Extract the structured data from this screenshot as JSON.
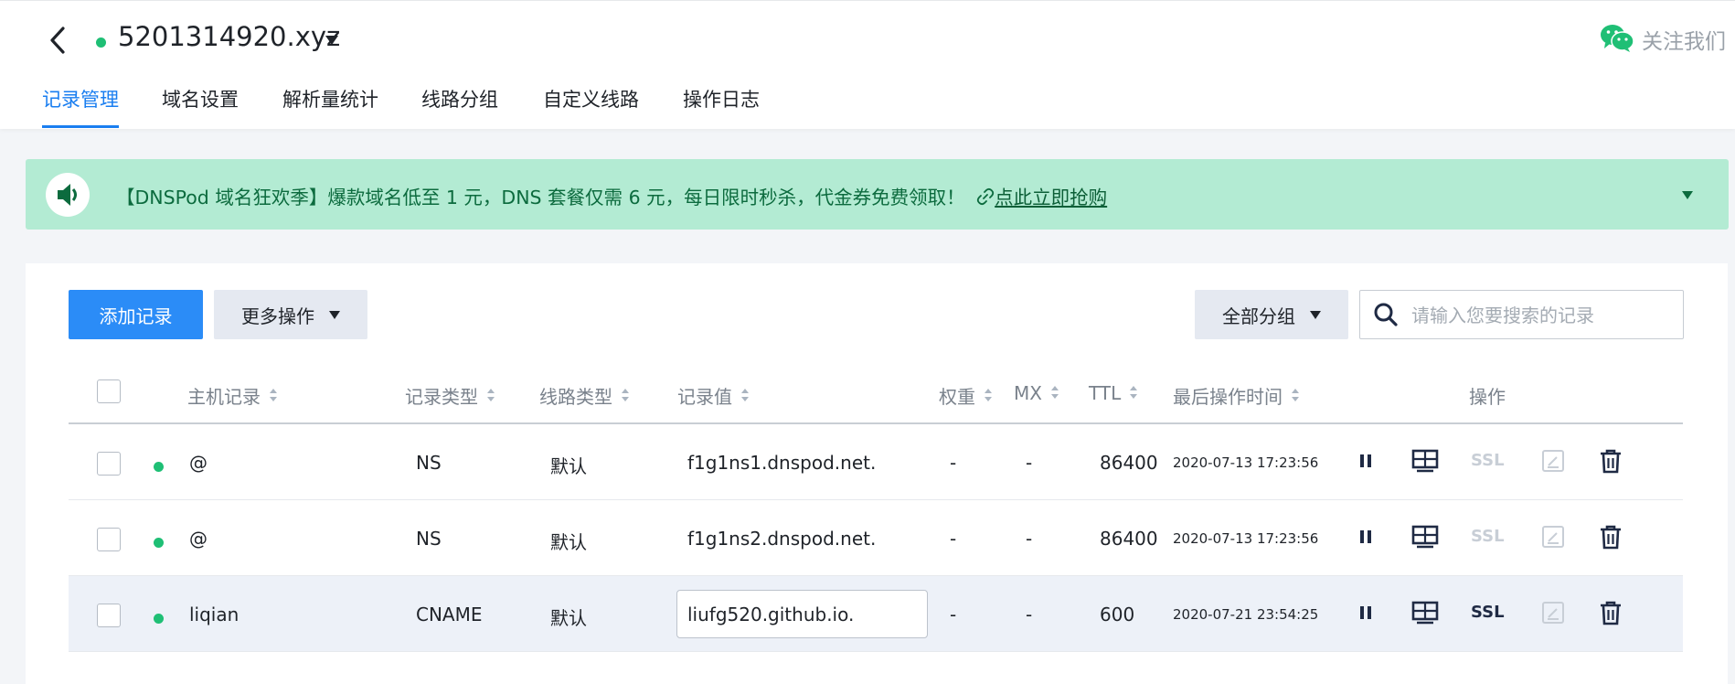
{
  "header": {
    "domain": "5201314920.xyz",
    "follow_label": "关注我们",
    "tabs": [
      "记录管理",
      "域名设置",
      "解析量统计",
      "线路分组",
      "自定义线路",
      "操作日志"
    ],
    "active_tab": "记录管理"
  },
  "banner": {
    "text": "【DNSPod 域名狂欢季】爆款域名低至 1 元，DNS 套餐仅需 6 元，每日限时秒杀，代金券免费领取！",
    "link": "点此立即抢购"
  },
  "toolbar": {
    "add_label": "添加记录",
    "more_label": "更多操作",
    "group_label": "全部分组",
    "search_placeholder": "请输入您要搜索的记录"
  },
  "table": {
    "columns": [
      "主机记录",
      "记录类型",
      "线路类型",
      "记录值",
      "权重",
      "MX",
      "TTL",
      "最后操作时间",
      "操作"
    ],
    "rows": [
      {
        "host": "@",
        "type": "NS",
        "line": "默认",
        "value": "f1g1ns1.dnspod.net.",
        "weight": "-",
        "mx": "-",
        "ttl": "86400",
        "time": "2020-07-13 17:23:56",
        "ssl": "SSL",
        "ssl_enabled": false
      },
      {
        "host": "@",
        "type": "NS",
        "line": "默认",
        "value": "f1g1ns2.dnspod.net.",
        "weight": "-",
        "mx": "-",
        "ttl": "86400",
        "time": "2020-07-13 17:23:56",
        "ssl": "SSL",
        "ssl_enabled": false
      },
      {
        "host": "liqian",
        "type": "CNAME",
        "line": "默认",
        "value": "liufg520.github.io.",
        "weight": "-",
        "mx": "-",
        "ttl": "600",
        "time": "2020-07-21 23:54:25",
        "ssl": "SSL",
        "ssl_enabled": true
      }
    ]
  },
  "colors": {
    "accent": "#1a7ef0",
    "banner_bg": "#b3ebd3",
    "status_green": "#1fbf75"
  },
  "icons": [
    "back-arrow-icon",
    "dropdown-caret-icon",
    "wechat-icon",
    "speaker-icon",
    "link-icon",
    "search-icon",
    "pause-icon",
    "monitor-icon",
    "edit-note-icon",
    "trash-icon"
  ]
}
